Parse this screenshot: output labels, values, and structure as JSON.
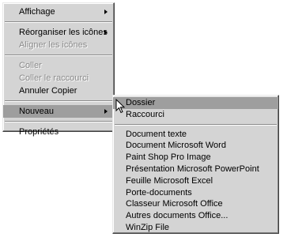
{
  "context_menu": {
    "items": [
      {
        "label": "Affichage"
      },
      {
        "label": "Réorganiser les icônes"
      },
      {
        "label": "Aligner les icônes"
      },
      {
        "label": "Coller"
      },
      {
        "label": "Coller le raccourci"
      },
      {
        "label": "Annuler Copier"
      },
      {
        "label": "Nouveau"
      },
      {
        "label": "Propriétés"
      }
    ]
  },
  "submenu_nouveau": {
    "items": [
      {
        "label": "Dossier"
      },
      {
        "label": "Raccourci"
      },
      {
        "label": "Document texte"
      },
      {
        "label": "Document Microsoft Word"
      },
      {
        "label": "Paint Shop Pro Image"
      },
      {
        "label": "Présentation Microsoft PowerPoint"
      },
      {
        "label": "Feuille Microsoft Excel"
      },
      {
        "label": "Porte-documents"
      },
      {
        "label": "Classeur Microsoft Office"
      },
      {
        "label": "Autres documents Office..."
      },
      {
        "label": "WinZip File"
      }
    ]
  },
  "icons": {
    "submenu_arrow": "chevron-right-icon",
    "cursor": "mouse-pointer-icon"
  },
  "colors": {
    "menu_background": "#d4d4d4",
    "highlight": "#9e9e9e",
    "disabled_text": "#8a8a8a"
  }
}
